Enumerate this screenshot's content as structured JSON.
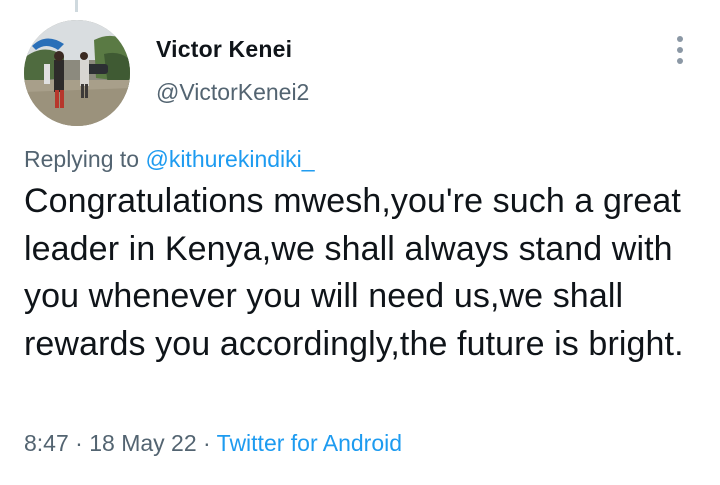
{
  "tweet": {
    "author": {
      "display_name": "Victor Kenei",
      "handle": "@VictorKenei2",
      "avatar": "profile-photo"
    },
    "more_icon": "vertical-ellipsis-icon",
    "replying_label": "Replying to",
    "replying_to": "@kithurekindiki_",
    "text": "Congratulations mwesh,you're such a great leader in Kenya,we shall always stand with you whenever you will need us,we shall rewards you accordingly,the future is bright.",
    "time": "8:47",
    "separator": "·",
    "date": "18 May 22",
    "source": "Twitter for Android"
  },
  "colors": {
    "text": "#0f1419",
    "secondary": "#536471",
    "link": "#1d9bf0",
    "icon": "#8b98a5",
    "background": "#ffffff"
  }
}
